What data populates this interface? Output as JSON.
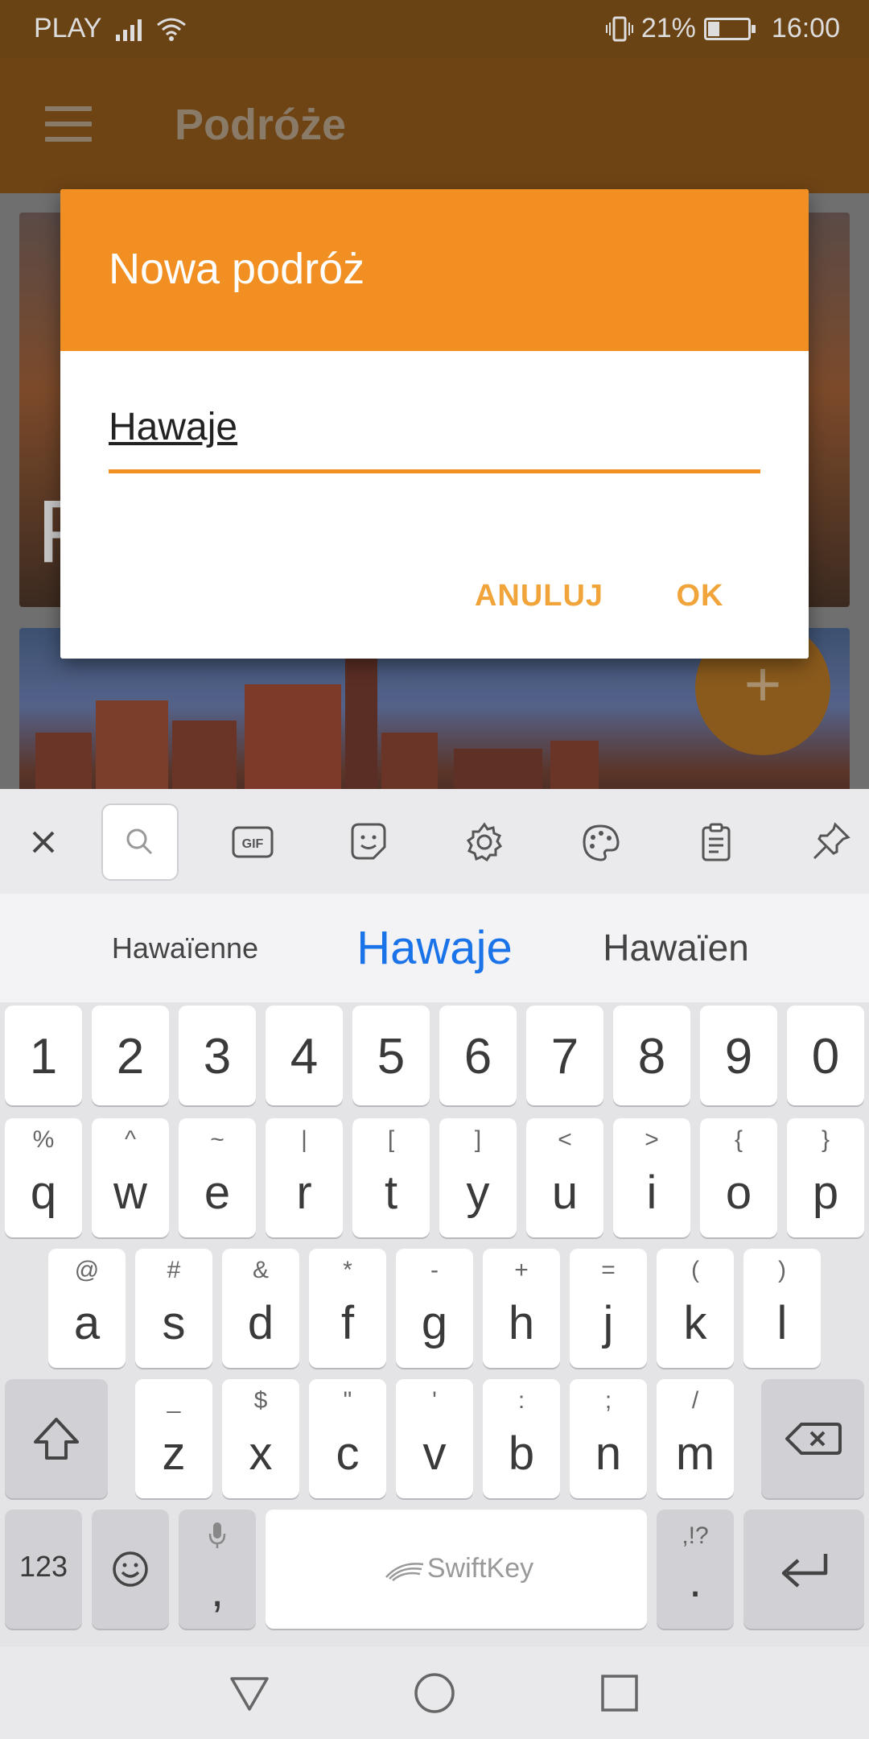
{
  "status_bar": {
    "carrier": "PLAY",
    "battery_percent": "21%",
    "time": "16:00"
  },
  "app_bar": {
    "title": "Podróże"
  },
  "dialog": {
    "title": "Nowa podróż",
    "input_value": "Hawaje",
    "cancel_label": "ANULUJ",
    "ok_label": "OK"
  },
  "fab": {
    "icon": "plus-icon",
    "label": "+"
  },
  "keyboard": {
    "toolbar_icons": [
      "close-icon",
      "search-icon",
      "gif-icon",
      "sticker-icon",
      "settings-icon",
      "theme-palette-icon",
      "clipboard-icon",
      "pin-icon"
    ],
    "gif_label": "GIF",
    "suggestions": {
      "left": "Hawaïenne",
      "center": "Hawaje",
      "right": "Hawaïen"
    },
    "number_row": [
      "1",
      "2",
      "3",
      "4",
      "5",
      "6",
      "7",
      "8",
      "9",
      "0"
    ],
    "row1": [
      {
        "main": "q",
        "sub": "%"
      },
      {
        "main": "w",
        "sub": "^"
      },
      {
        "main": "e",
        "sub": "~"
      },
      {
        "main": "r",
        "sub": "|"
      },
      {
        "main": "t",
        "sub": "["
      },
      {
        "main": "y",
        "sub": "]"
      },
      {
        "main": "u",
        "sub": "<"
      },
      {
        "main": "i",
        "sub": ">"
      },
      {
        "main": "o",
        "sub": "{"
      },
      {
        "main": "p",
        "sub": "}"
      }
    ],
    "row2": [
      {
        "main": "a",
        "sub": "@"
      },
      {
        "main": "s",
        "sub": "#"
      },
      {
        "main": "d",
        "sub": "&"
      },
      {
        "main": "f",
        "sub": "*"
      },
      {
        "main": "g",
        "sub": "-"
      },
      {
        "main": "h",
        "sub": "+"
      },
      {
        "main": "j",
        "sub": "="
      },
      {
        "main": "k",
        "sub": "("
      },
      {
        "main": "l",
        "sub": ")"
      }
    ],
    "row3": [
      {
        "main": "z",
        "sub": "_"
      },
      {
        "main": "x",
        "sub": "$"
      },
      {
        "main": "c",
        "sub": "\""
      },
      {
        "main": "v",
        "sub": "'"
      },
      {
        "main": "b",
        "sub": ":"
      },
      {
        "main": "n",
        "sub": ";"
      },
      {
        "main": "m",
        "sub": "/"
      }
    ],
    "bottom_row": {
      "numbers_label": "123",
      "comma": ",",
      "space_label": "SwiftKey",
      "period": ".",
      "period_sub": ",!?"
    }
  },
  "nav_bar": {
    "icons": [
      "back-triangle-icon",
      "home-circle-icon",
      "recents-square-icon"
    ]
  },
  "colors": {
    "accent": "#f18f22",
    "suggestion_highlight": "#1a73e8"
  }
}
